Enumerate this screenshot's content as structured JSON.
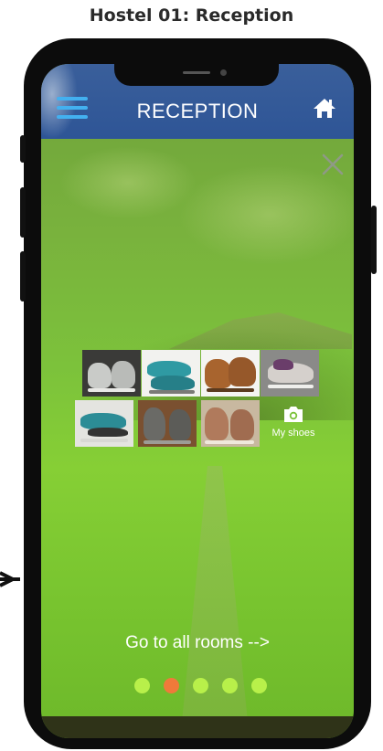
{
  "caption": "Hostel 01: Reception",
  "header": {
    "title": "RECEPTION",
    "menu_icon": "hamburger-menu-icon",
    "home_icon": "home-icon",
    "accent": "#43b0f0",
    "bar_color": "#2e5596"
  },
  "overlay": {
    "close_icon": "close-icon",
    "tint": "#7cc23b"
  },
  "gallery": {
    "tiles": [
      {
        "name": "shoe-photo-1",
        "bg": "#3a3a38",
        "shoe": "#c9cbc8",
        "sole": "#e9e9e6"
      },
      {
        "name": "shoe-photo-2",
        "bg": "#f2f2ef",
        "shoe": "#2f9aa3",
        "sole": "#e4e4e0"
      },
      {
        "name": "shoe-photo-3",
        "bg": "#f4f4f2",
        "shoe": "#a8642e",
        "sole": "#5a3a1e"
      },
      {
        "name": "shoe-photo-4",
        "bg": "#8a8a88",
        "shoe": "#d5d0cc",
        "sole": "#efefec"
      },
      {
        "name": "shoe-photo-5",
        "bg": "#e4e4e0",
        "shoe": "#2c8c96",
        "sole": "#d8d8d4"
      },
      {
        "name": "shoe-photo-6",
        "bg": "#7a5030",
        "shoe": "#6a6a66",
        "sole": "#9c9c96"
      },
      {
        "name": "shoe-photo-7",
        "bg": "#c8b8a0",
        "shoe": "#b07a5c",
        "sole": "#efe8dc"
      }
    ],
    "add_label": "My shoes",
    "add_icon": "camera-icon"
  },
  "navigation": {
    "goto_label": "Go to all rooms -->",
    "dots": [
      {
        "color": "#b8f04a",
        "active": false
      },
      {
        "color": "#f07a3a",
        "active": true
      },
      {
        "color": "#b8f04a",
        "active": false
      },
      {
        "color": "#b8f04a",
        "active": false
      },
      {
        "color": "#b8f04a",
        "active": false
      }
    ]
  }
}
